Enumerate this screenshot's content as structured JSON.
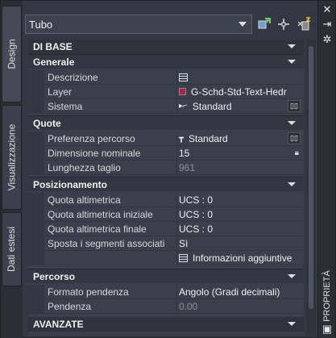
{
  "tabs": {
    "design": "Design",
    "visualizzazione": "Visualizzazione",
    "dati_estesi": "Dati estesi"
  },
  "right_panel_label": "PROPRIETÀ",
  "selector": {
    "value": "Tubo"
  },
  "sections": {
    "di_base": "DI BASE",
    "generale": "Generale",
    "quote": "Quote",
    "posizionamento": "Posizionamento",
    "percorso": "Percorso",
    "avanzate": "AVANZATE"
  },
  "props": {
    "descrizione": {
      "label": "Descrizione",
      "value": ""
    },
    "layer": {
      "label": "Layer",
      "value": "G-Schd-Std-Text-Hedr"
    },
    "sistema": {
      "label": "Sistema",
      "value": "Standard"
    },
    "preferenza_percorso": {
      "label": "Preferenza percorso",
      "value": "Standard"
    },
    "dimensione_nominale": {
      "label": "Dimensione nominale",
      "value": "15"
    },
    "lunghezza_taglio": {
      "label": "Lunghezza taglio",
      "value": "961"
    },
    "quota_altimetrica": {
      "label": "Quota altimetrica",
      "value": "UCS : 0"
    },
    "quota_altimetrica_iniziale": {
      "label": "Quota altimetrica iniziale",
      "value": "UCS : 0"
    },
    "quota_altimetrica_finale": {
      "label": "Quota altimetrica finale",
      "value": "UCS : 0"
    },
    "sposta_segmenti": {
      "label": "Sposta i segmenti associati",
      "value": "Sì"
    },
    "informazioni": {
      "label": "",
      "value": "Informazioni aggiuntive"
    },
    "formato_pendenza": {
      "label": "Formato pendenza",
      "value": "Angolo (Gradi decimali)"
    },
    "pendenza": {
      "label": "Pendenza",
      "value": "0.00"
    }
  },
  "colors": {
    "layer_swatch": "#b0204a",
    "background": "#333842",
    "section": "#2f343c"
  }
}
